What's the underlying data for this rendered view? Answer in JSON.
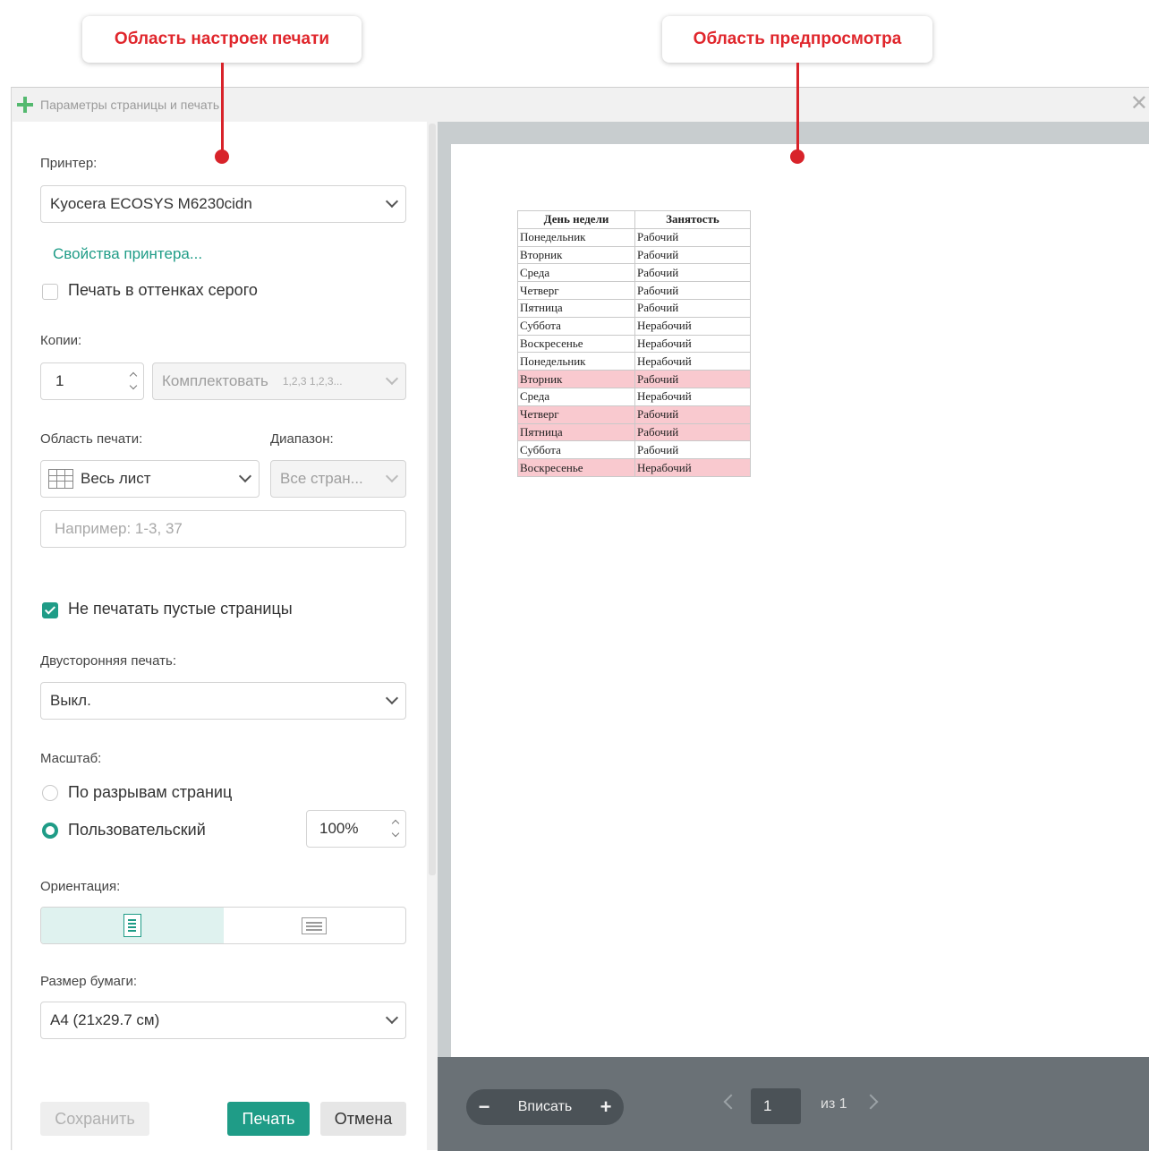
{
  "callouts": {
    "left": "Область настроек печати",
    "right": "Область предпросмотра"
  },
  "window": {
    "title": "Параметры страницы и печать"
  },
  "settings": {
    "printer_label": "Принтер:",
    "printer_value": "Kyocera ECOSYS M6230cidn",
    "printer_properties_link": "Свойства принтера...",
    "grayscale_label": "Печать в оттенках серого",
    "grayscale_checked": false,
    "copies_label": "Копии:",
    "copies_value": "1",
    "collate_label": "Комплектовать",
    "collate_hint": "1,2,3 1,2,3...",
    "print_area_label": "Область печати:",
    "print_area_value": "Весь лист",
    "range_label": "Диапазон:",
    "range_value": "Все стран...",
    "pages_placeholder": "Например: 1-3, 37",
    "skip_blank_label": "Не печатать пустые страницы",
    "skip_blank_checked": true,
    "duplex_label": "Двусторонняя печать:",
    "duplex_value": "Выкл.",
    "scale_label": "Масштаб:",
    "scale_option_breaks": "По разрывам страниц",
    "scale_option_custom": "Пользовательский",
    "scale_selected": "custom",
    "scale_value": "100%",
    "orientation_label": "Ориентация:",
    "orientation_selected": "portrait",
    "paper_size_label": "Размер бумаги:",
    "paper_size_value": "А4 (21x29.7 см)",
    "buttons": {
      "save": "Сохранить",
      "print": "Печать",
      "cancel": "Отмена"
    }
  },
  "preview": {
    "table": {
      "headers": [
        "День недели",
        "Занятость"
      ],
      "rows": [
        {
          "day": "Понедельник",
          "status": "Рабочий",
          "highlight": false
        },
        {
          "day": "Вторник",
          "status": "Рабочий",
          "highlight": false
        },
        {
          "day": "Среда",
          "status": "Рабочий",
          "highlight": false
        },
        {
          "day": "Четверг",
          "status": "Рабочий",
          "highlight": false
        },
        {
          "day": "Пятница",
          "status": "Рабочий",
          "highlight": false
        },
        {
          "day": "Суббота",
          "status": "Нерабочий",
          "highlight": false
        },
        {
          "day": "Воскресенье",
          "status": "Нерабочий",
          "highlight": false
        },
        {
          "day": "Понедельник",
          "status": "Нерабочий",
          "highlight": false
        },
        {
          "day": "Вторник",
          "status": "Рабочий",
          "highlight": true
        },
        {
          "day": "Среда",
          "status": "Нерабочий",
          "highlight": false
        },
        {
          "day": "Четверг",
          "status": "Рабочий",
          "highlight": true
        },
        {
          "day": "Пятница",
          "status": "Рабочий",
          "highlight": true
        },
        {
          "day": "Суббота",
          "status": "Рабочий",
          "highlight": false
        },
        {
          "day": "Воскресенье",
          "status": "Нерабочий",
          "highlight": true
        }
      ]
    },
    "zoom_fit_label": "Вписать",
    "zoom_minus": "−",
    "zoom_plus": "+",
    "page_current": "1",
    "page_of": "из 1"
  },
  "colors": {
    "accent": "#1f9c87",
    "callout_red": "#e0262c",
    "highlight_row": "#f9c9cf"
  },
  "icons": [
    "app-icon",
    "close-icon",
    "chevron-down-icon",
    "spinner-icon",
    "grid-icon",
    "portrait-icon",
    "landscape-icon",
    "chevron-left-icon",
    "chevron-right-icon"
  ]
}
